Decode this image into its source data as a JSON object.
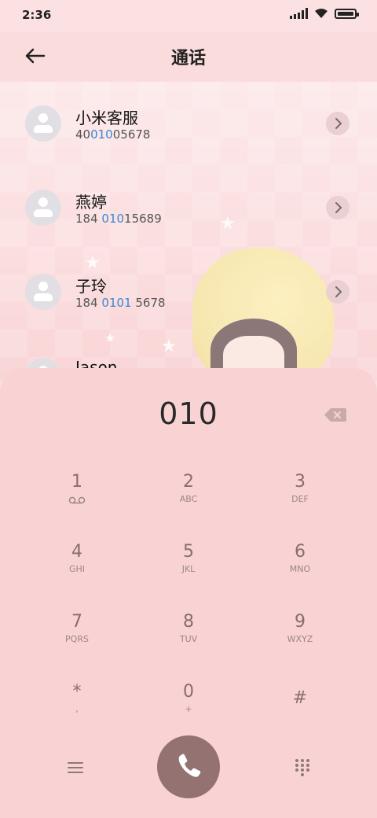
{
  "status_bar": {
    "time": "2:36"
  },
  "header": {
    "title": "通话"
  },
  "contacts": [
    {
      "name": "小米客服",
      "num_pre": "40",
      "num_hl": "010",
      "num_post": "05678"
    },
    {
      "name": "燕婷",
      "num_pre": "184 ",
      "num_hl": "010",
      "num_post": "15689"
    },
    {
      "name": "子玲",
      "num_pre": "184 ",
      "num_hl": "0101",
      "num_post": " 5678"
    },
    {
      "name": "Jason",
      "num_pre": "",
      "num_hl": "",
      "num_post": ""
    }
  ],
  "dialer": {
    "input": "010",
    "keys": [
      {
        "digit": "1",
        "letters": "⌁"
      },
      {
        "digit": "2",
        "letters": "ABC"
      },
      {
        "digit": "3",
        "letters": "DEF"
      },
      {
        "digit": "4",
        "letters": "GHI"
      },
      {
        "digit": "5",
        "letters": "JKL"
      },
      {
        "digit": "6",
        "letters": "MNO"
      },
      {
        "digit": "7",
        "letters": "PQRS"
      },
      {
        "digit": "8",
        "letters": "TUV"
      },
      {
        "digit": "9",
        "letters": "WXYZ"
      },
      {
        "digit": "*",
        "letters": ","
      },
      {
        "digit": "0",
        "letters": "+"
      },
      {
        "digit": "#",
        "letters": ""
      }
    ]
  },
  "colors": {
    "accent": "#3a86d6",
    "call_button": "#957272",
    "dialer_bg": "#f9d3d3"
  }
}
